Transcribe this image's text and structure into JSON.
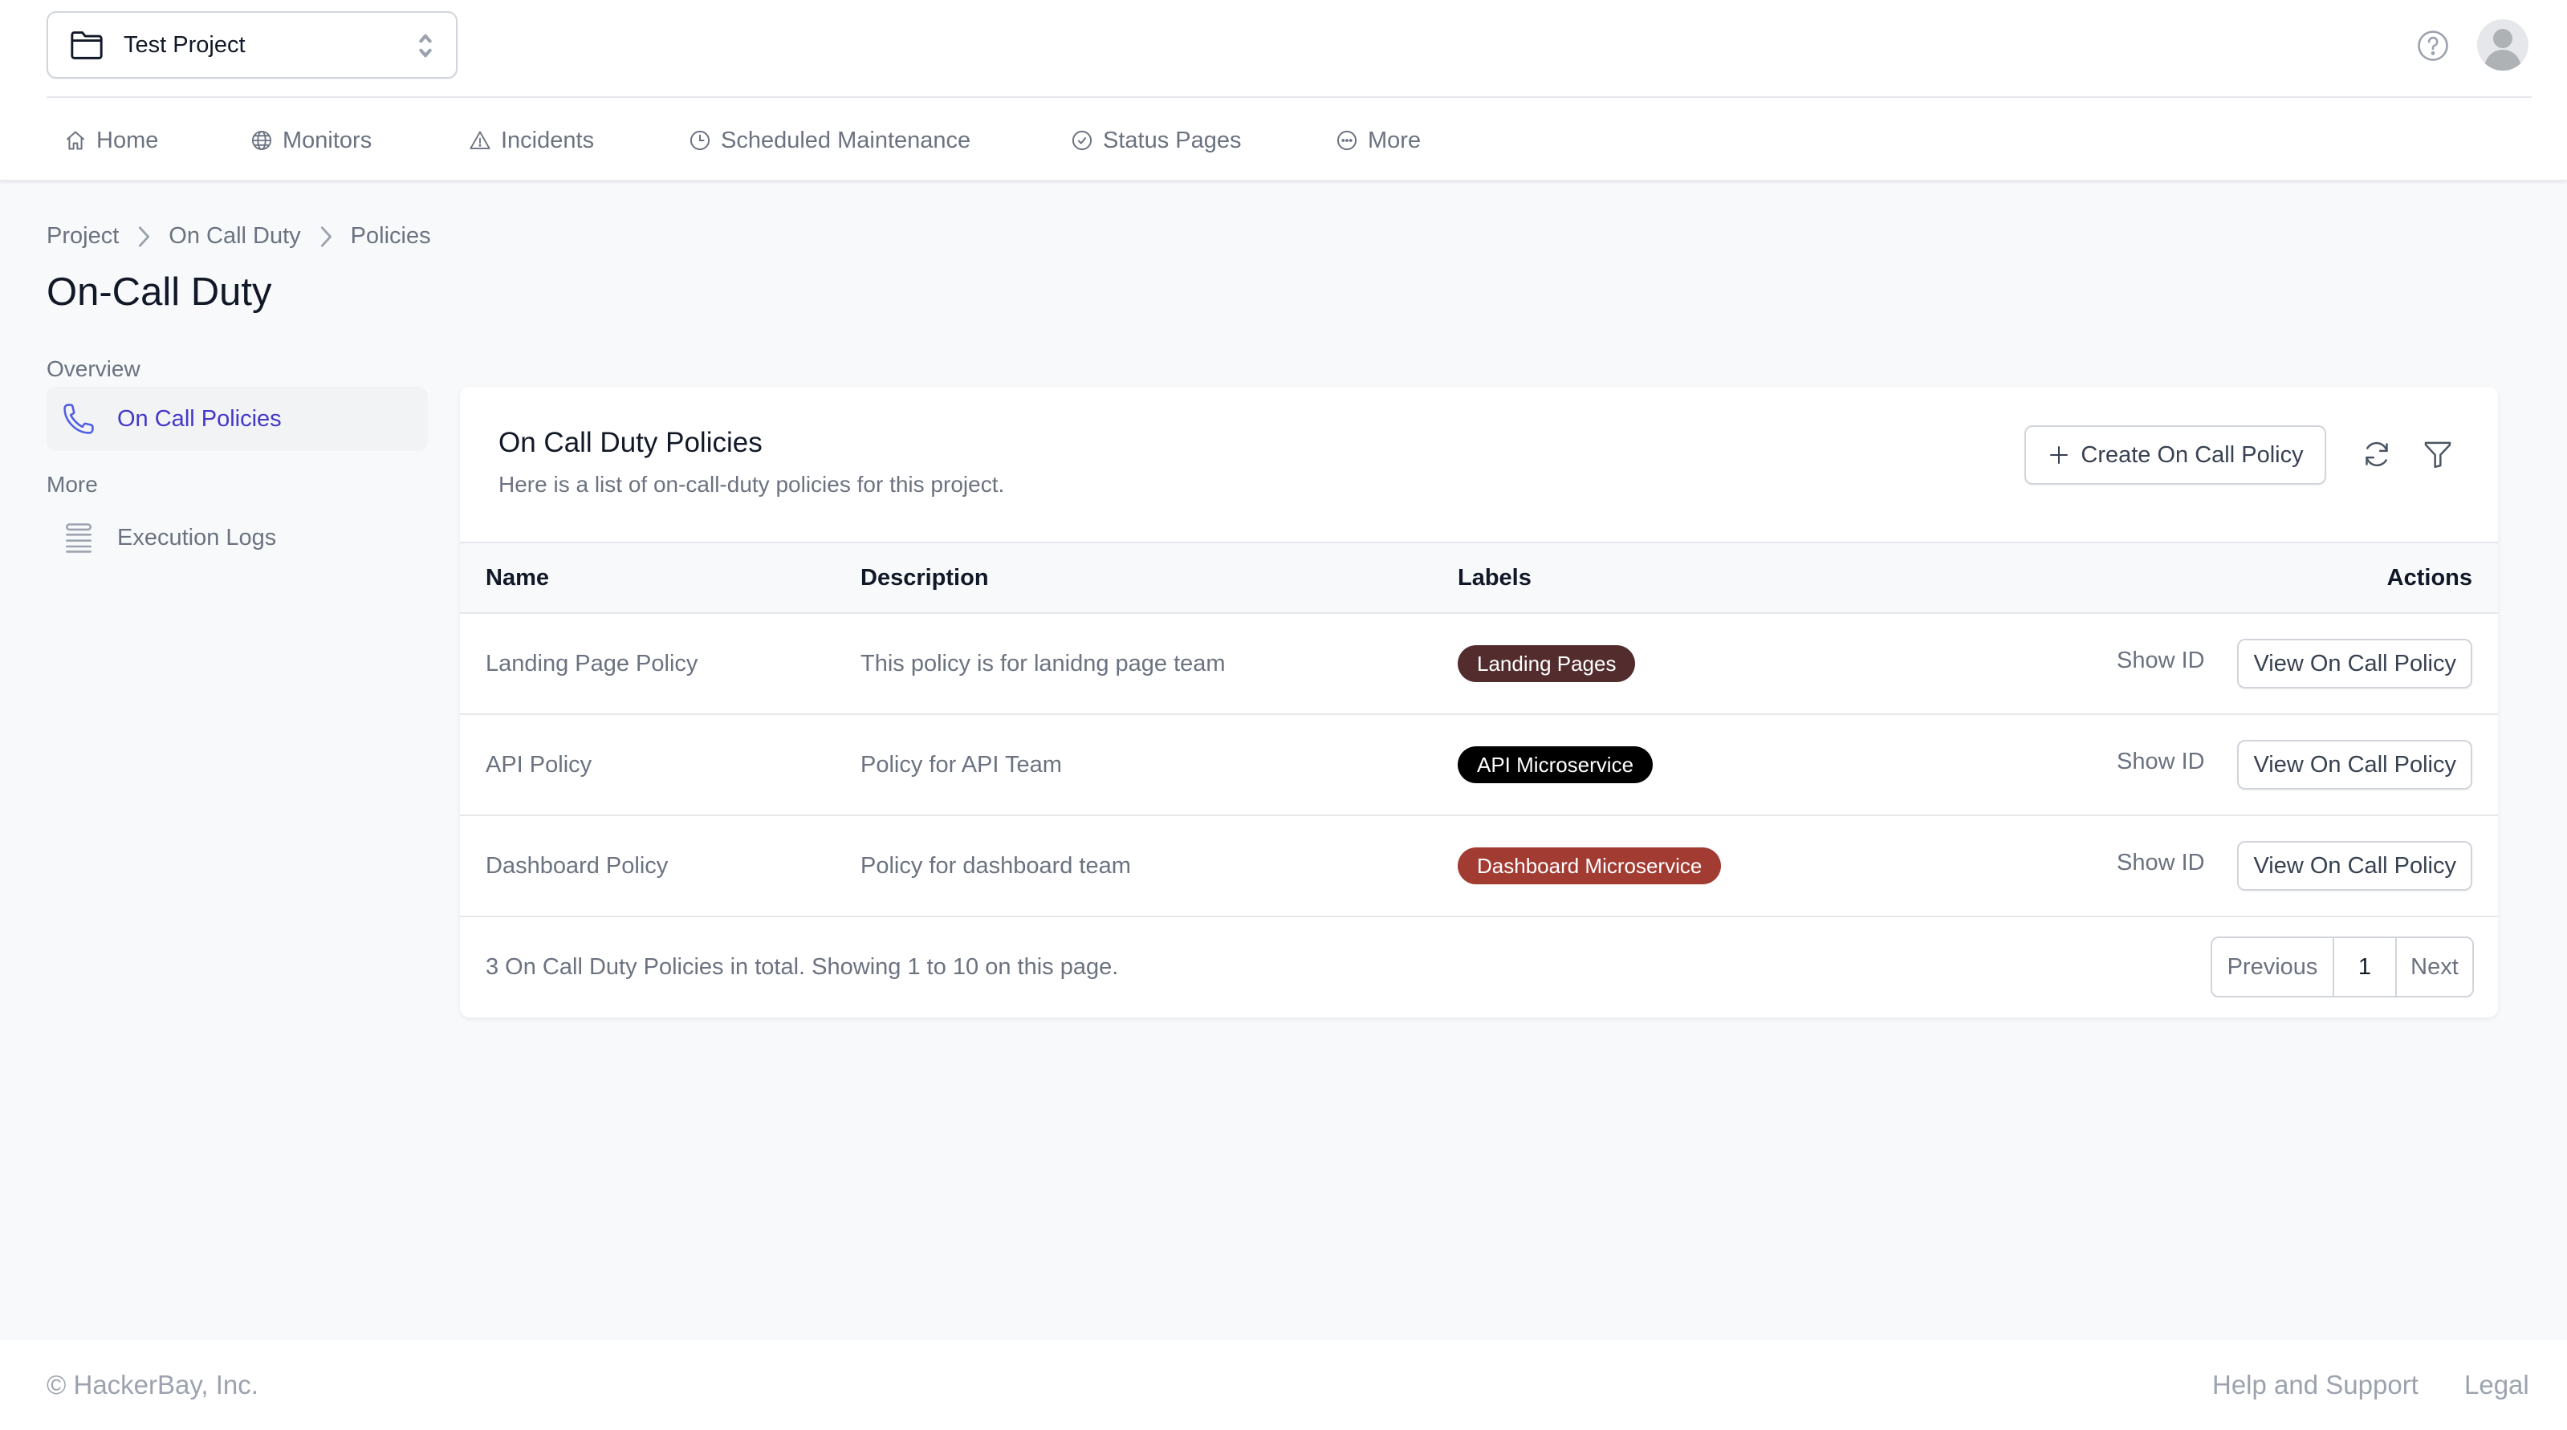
{
  "header": {
    "project_selector": {
      "value": "Test Project",
      "icon": "folder-icon"
    },
    "help_icon": "question-circle-icon",
    "avatar": "user-avatar"
  },
  "nav": [
    {
      "label": "Home",
      "icon": "home-icon"
    },
    {
      "label": "Monitors",
      "icon": "globe-icon"
    },
    {
      "label": "Incidents",
      "icon": "alert-triangle-icon"
    },
    {
      "label": "Scheduled Maintenance",
      "icon": "clock-icon"
    },
    {
      "label": "Status Pages",
      "icon": "check-circle-icon"
    },
    {
      "label": "More",
      "icon": "more-circle-icon"
    }
  ],
  "breadcrumb": [
    "Project",
    "On Call Duty",
    "Policies"
  ],
  "page_title": "On-Call Duty",
  "sidebar": {
    "sections": [
      {
        "heading": "Overview",
        "items": [
          {
            "label": "On Call Policies",
            "icon": "phone-icon",
            "active": true
          }
        ]
      },
      {
        "heading": "More",
        "items": [
          {
            "label": "Execution Logs",
            "icon": "list-icon",
            "active": false
          }
        ]
      }
    ]
  },
  "card": {
    "title": "On Call Duty Policies",
    "description": "Here is a list of on-call-duty policies for this project.",
    "create_button": "Create On Call Policy",
    "refresh_icon": "refresh-icon",
    "filter_icon": "filter-icon"
  },
  "table": {
    "columns": [
      "Name",
      "Description",
      "Labels",
      "Actions"
    ],
    "rows": [
      {
        "name": "Landing Page Policy",
        "description": "This policy is for lanidng page team",
        "label": {
          "text": "Landing Pages",
          "color": "#532d2d"
        },
        "show_id": "Show ID",
        "view": "View On Call Policy"
      },
      {
        "name": "API Policy",
        "description": "Policy for API Team",
        "label": {
          "text": "API Microservice",
          "color": "#000000"
        },
        "show_id": "Show ID",
        "view": "View On Call Policy"
      },
      {
        "name": "Dashboard Policy",
        "description": "Policy for dashboard team",
        "label": {
          "text": "Dashboard Microservice",
          "color": "#a23b32"
        },
        "show_id": "Show ID",
        "view": "View On Call Policy"
      }
    ],
    "summary": "3 On Call Duty Policies in total. Showing 1 to 10 on this page.",
    "pagination": {
      "previous": "Previous",
      "current": "1",
      "next": "Next"
    }
  },
  "footer": {
    "copyright": "© HackerBay, Inc.",
    "links": [
      "Help and Support",
      "Legal"
    ]
  },
  "colors": {
    "accent": "#4338ca",
    "muted_text": "#6b7280",
    "border": "#d1d5db",
    "background": "#f8f9fb"
  }
}
